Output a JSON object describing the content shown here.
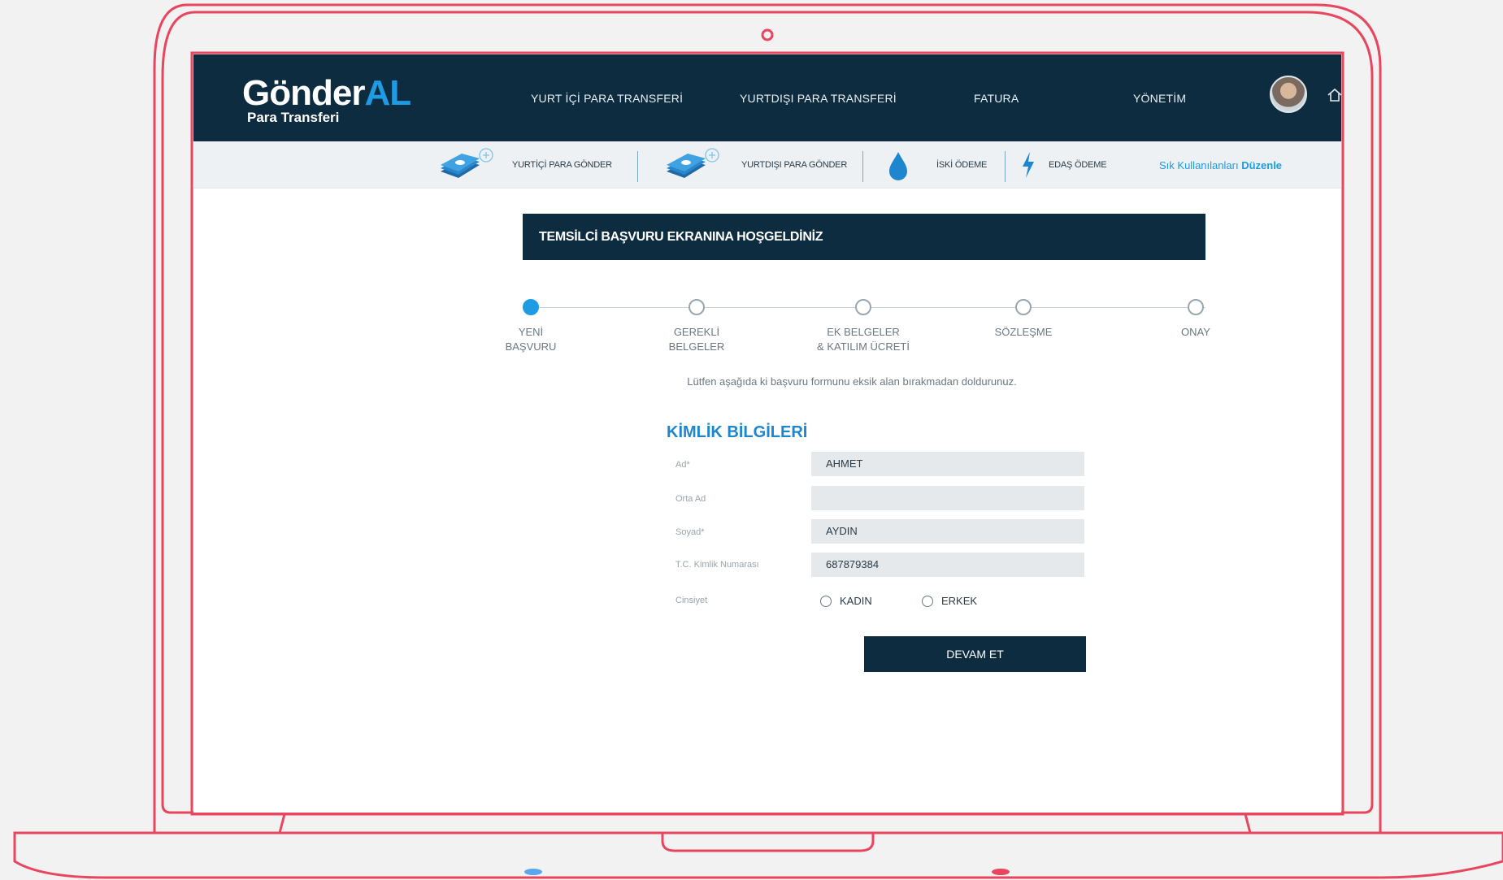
{
  "brand": {
    "logo_part1": "Gönder",
    "logo_part2": "AL",
    "subtitle": "Para Transferi",
    "accent_color": "#1e9be3",
    "navy_color": "#0e2c40",
    "frame_color": "#e8455e"
  },
  "nav": {
    "items": [
      {
        "label": "YURT İÇİ PARA TRANSFERİ"
      },
      {
        "label": "YURTDIŞI PARA TRANSFERİ"
      },
      {
        "label": "FATURA"
      },
      {
        "label": "YÖNETİM"
      }
    ],
    "avatar_icon": "user-avatar",
    "home_icon": "home-icon"
  },
  "shortcuts": {
    "items": [
      {
        "label": "YURTİÇİ PARA GÖNDER",
        "icon": "money-stack-plus-icon"
      },
      {
        "label": "YURTDIŞI PARA GÖNDER",
        "icon": "money-stack-plus-icon"
      },
      {
        "label": "İSKİ ÖDEME",
        "icon": "water-drop-icon"
      },
      {
        "label": "EDAŞ ÖDEME",
        "icon": "lightning-icon"
      }
    ],
    "edit_prefix": "Sık Kullanılanları",
    "edit_bold": "Düzenle"
  },
  "welcome": {
    "title": "TEMSİLCİ BAŞVURU EKRANINA HOŞGELDİNİZ"
  },
  "stepper": {
    "active_index": 0,
    "steps": [
      {
        "line1": "YENİ",
        "line2": "BAŞVURU"
      },
      {
        "line1": "GEREKLİ",
        "line2": "BELGELER"
      },
      {
        "line1": "EK BELGELER",
        "line2": "& KATILIM ÜCRETİ"
      },
      {
        "line1": "SÖZLEŞME",
        "line2": ""
      },
      {
        "line1": "ONAY",
        "line2": ""
      }
    ]
  },
  "instructions": "Lütfen aşağıda ki başvuru formunu eksik alan bırakmadan doldurunuz.",
  "form": {
    "section_title": "KİMLİK BİLGİLERİ",
    "fields": [
      {
        "label": "Ad*",
        "value": "AHMET"
      },
      {
        "label": "Orta Ad",
        "value": ""
      },
      {
        "label": "Soyad*",
        "value": "AYDIN"
      },
      {
        "label": "T.C. Kimlik Numarası",
        "value": "687879384"
      }
    ],
    "gender": {
      "label": "Cinsiyet",
      "options": [
        "KADIN",
        "ERKEK"
      ]
    },
    "submit_label": "DEVAM ET"
  }
}
